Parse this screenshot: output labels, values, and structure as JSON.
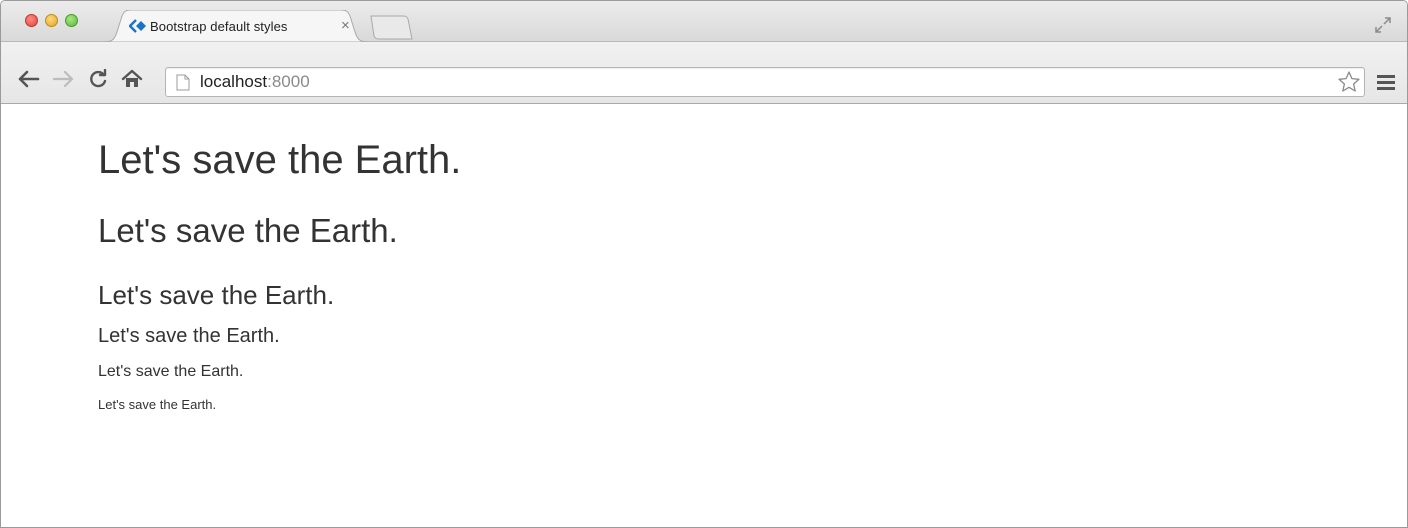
{
  "browser": {
    "tab": {
      "title": "Bootstrap default styles",
      "close_glyph": "×"
    },
    "address": {
      "host": "localhost",
      "port": ":8000"
    },
    "icons": {
      "back": "back-arrow-icon",
      "forward": "forward-arrow-icon",
      "reload": "reload-icon",
      "home": "home-icon",
      "page": "page-icon",
      "bookmark": "star-icon",
      "menu": "hamburger-menu-icon",
      "favicon": "bootstrap-favicon-icon",
      "fullscreen": "fullscreen-icon"
    }
  },
  "page": {
    "headings": [
      "Let's save the Earth.",
      "Let's save the Earth.",
      "Let's save the Earth.",
      "Let's save the Earth.",
      "Let's save the Earth.",
      "Let's save the Earth."
    ]
  },
  "colors": {
    "text": "#333333",
    "favicon_accent": "#1a73c9"
  }
}
